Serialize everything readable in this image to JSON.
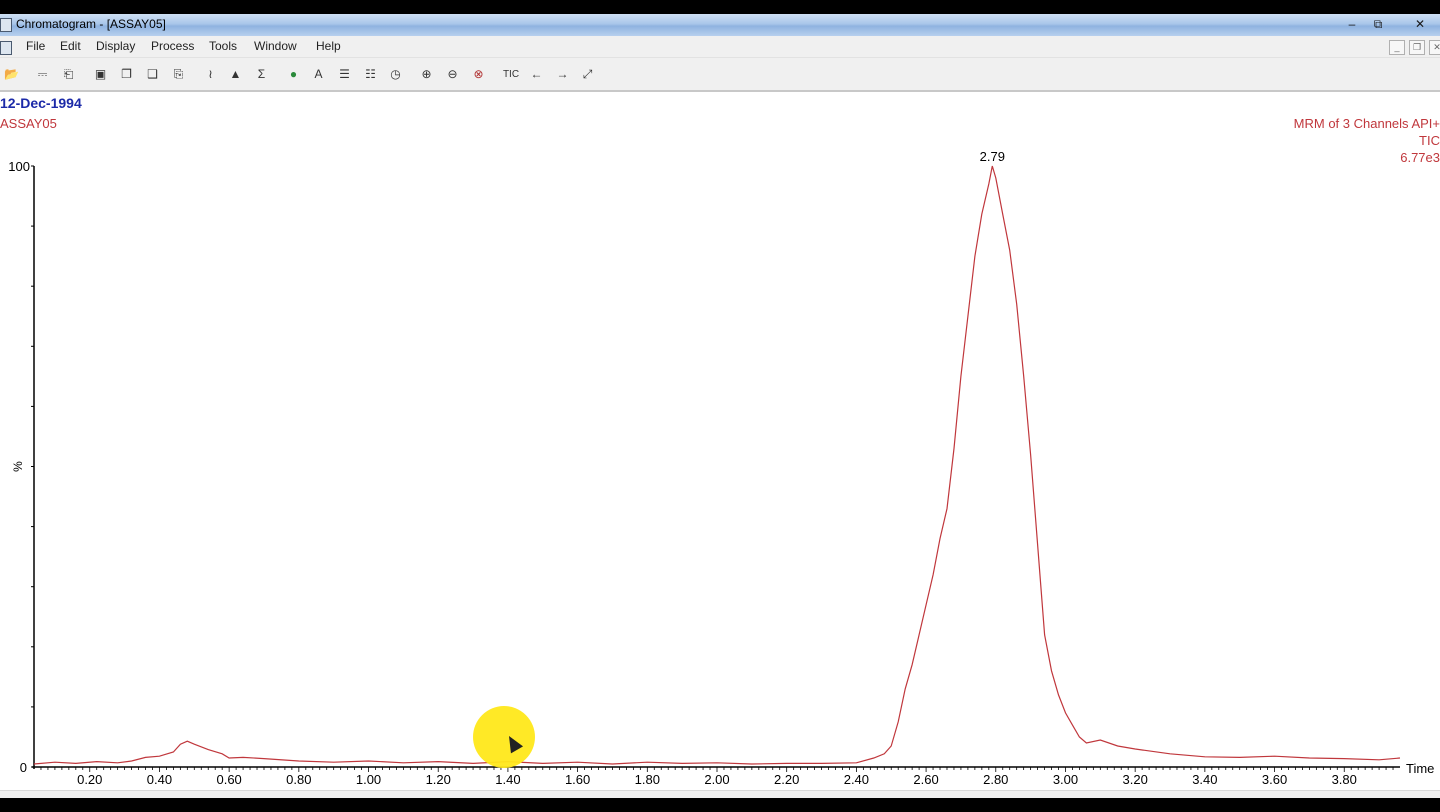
{
  "window": {
    "title": "Chromatogram - [ASSAY05]",
    "controls": {
      "minimize": "–",
      "restore": "⧉",
      "close": "✕"
    }
  },
  "menu": {
    "items": [
      "File",
      "Edit",
      "Display",
      "Process",
      "Tools",
      "Window",
      "Help"
    ],
    "mdi_controls": {
      "minimize": "_",
      "restore": "❐",
      "close": "✕"
    }
  },
  "toolbar": {
    "icons": [
      {
        "name": "open-icon",
        "glyph": "📂"
      },
      {
        "name": "print-preview-icon",
        "glyph": "⎓"
      },
      {
        "name": "print-icon",
        "glyph": "⎗"
      },
      {
        "name": "camera-icon",
        "glyph": "▣"
      },
      {
        "name": "copy-icon",
        "glyph": "❐"
      },
      {
        "name": "copy-list-icon",
        "glyph": "❑"
      },
      {
        "name": "paste-icon",
        "glyph": "⎘"
      },
      {
        "name": "integrate-icon",
        "glyph": "≀"
      },
      {
        "name": "peak-icon",
        "glyph": "▲"
      },
      {
        "name": "combine-icon",
        "glyph": "Σ"
      },
      {
        "name": "globe-icon",
        "glyph": "●"
      },
      {
        "name": "text-icon",
        "glyph": "A"
      },
      {
        "name": "header-icon",
        "glyph": "☰"
      },
      {
        "name": "layout-icon",
        "glyph": "☷"
      },
      {
        "name": "timer-icon",
        "glyph": "◷"
      },
      {
        "name": "zoom-in-icon",
        "glyph": "⊕"
      },
      {
        "name": "zoom-out-icon",
        "glyph": "⊖"
      },
      {
        "name": "zoom-reset-icon",
        "glyph": "⊗"
      },
      {
        "name": "tic-icon",
        "glyph": "TIC"
      },
      {
        "name": "back-icon",
        "glyph": "←"
      },
      {
        "name": "forward-icon",
        "glyph": "→"
      },
      {
        "name": "fullscreen-icon",
        "glyph": "⤢"
      }
    ]
  },
  "header": {
    "date": "12-Dec-1994",
    "file": "ASSAY05",
    "channel_info": [
      "MRM of 3 Channels API+",
      "TIC",
      "6.77e3"
    ]
  },
  "colors": {
    "trace": "#c0373c",
    "date_text": "#1c2aa8",
    "axis": "#000000",
    "cursor_highlight": "#ffe81a"
  },
  "chart_data": {
    "type": "line",
    "title": "",
    "xlabel": "Time",
    "ylabel": "%",
    "xlim": [
      0.04,
      3.96
    ],
    "ylim": [
      0,
      100
    ],
    "x_ticks": [
      "0.20",
      "0.40",
      "0.60",
      "0.80",
      "1.00",
      "1.20",
      "1.40",
      "1.60",
      "1.80",
      "2.00",
      "2.20",
      "2.40",
      "2.60",
      "2.80",
      "3.00",
      "3.20",
      "3.40",
      "3.60",
      "3.80"
    ],
    "y_ticks": [
      "0",
      "100"
    ],
    "peak_label": {
      "x": 2.79,
      "text": "2.79"
    },
    "series": [
      {
        "x": [
          0.04,
          0.1,
          0.16,
          0.22,
          0.28,
          0.32,
          0.36,
          0.4,
          0.44,
          0.46,
          0.48,
          0.5,
          0.54,
          0.58,
          0.6,
          0.64,
          0.7,
          0.8,
          0.9,
          1.0,
          1.1,
          1.2,
          1.3,
          1.4,
          1.5,
          1.6,
          1.7,
          1.8,
          1.9,
          2.0,
          2.1,
          2.2,
          2.3,
          2.4,
          2.45,
          2.48,
          2.5,
          2.52,
          2.54,
          2.56,
          2.58,
          2.6,
          2.62,
          2.64,
          2.66,
          2.68,
          2.7,
          2.72,
          2.74,
          2.76,
          2.78,
          2.79,
          2.8,
          2.82,
          2.84,
          2.86,
          2.88,
          2.9,
          2.92,
          2.94,
          2.96,
          2.98,
          3.0,
          3.02,
          3.04,
          3.06,
          3.1,
          3.15,
          3.2,
          3.3,
          3.4,
          3.5,
          3.6,
          3.7,
          3.8,
          3.9,
          3.96
        ],
        "y": [
          0.5,
          0.8,
          0.6,
          0.9,
          0.7,
          1.0,
          1.6,
          1.8,
          2.5,
          3.8,
          4.3,
          3.8,
          2.9,
          2.2,
          1.5,
          1.6,
          1.4,
          1.0,
          0.8,
          1.0,
          0.7,
          0.9,
          0.6,
          0.9,
          0.6,
          0.8,
          0.5,
          0.8,
          0.6,
          0.7,
          0.5,
          0.6,
          0.6,
          0.7,
          1.5,
          2.2,
          3.5,
          7.5,
          13,
          17,
          22,
          27,
          32,
          38,
          43,
          53,
          65,
          75,
          85,
          92,
          97,
          100,
          98,
          92,
          86,
          77,
          65,
          52,
          37,
          22,
          16,
          12,
          9,
          7,
          5,
          4,
          4.5,
          3.5,
          3,
          2.2,
          1.7,
          1.6,
          1.8,
          1.5,
          1.4,
          1.2,
          1.5
        ]
      }
    ]
  }
}
